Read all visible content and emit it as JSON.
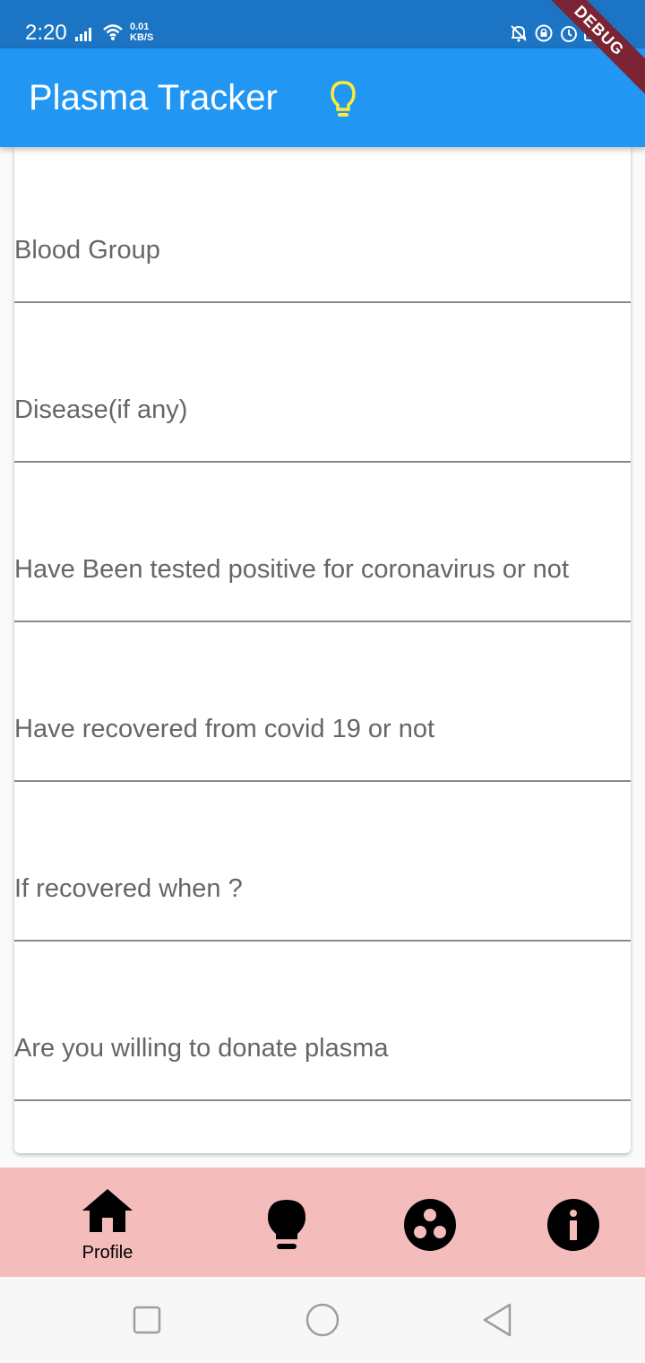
{
  "status_bar": {
    "time": "2:20",
    "net_speed_value": "0.01",
    "net_speed_unit": "KB/S",
    "icons": [
      "signal-icon",
      "wifi-icon",
      "mute-bell-icon",
      "rotation-lock-icon",
      "alarm-icon",
      "battery-icon"
    ]
  },
  "debug_banner": "DEBUG",
  "app_bar": {
    "title": "Plasma Tracker",
    "action_icon": "lightbulb-icon",
    "background": "#2196f3",
    "action_color": "#ffeb3b"
  },
  "form": {
    "fields": [
      {
        "label": "Blood Group"
      },
      {
        "label": "Disease(if any)"
      },
      {
        "label": "Have Been tested positive for coronavirus or not"
      },
      {
        "label": "Have recovered from covid 19 or not"
      },
      {
        "label": "If recovered when ?"
      },
      {
        "label": "Are you willing to donate plasma"
      }
    ]
  },
  "bottom_nav": {
    "background": "#f5bcbc",
    "items": [
      {
        "icon": "home-icon",
        "label": "Profile",
        "selected": true
      },
      {
        "icon": "lightbulb-icon",
        "label": ""
      },
      {
        "icon": "group-icon",
        "label": ""
      },
      {
        "icon": "info-icon",
        "label": ""
      }
    ]
  },
  "system_nav": {
    "icons": [
      "recents-square-icon",
      "home-circle-icon",
      "back-triangle-icon"
    ]
  }
}
